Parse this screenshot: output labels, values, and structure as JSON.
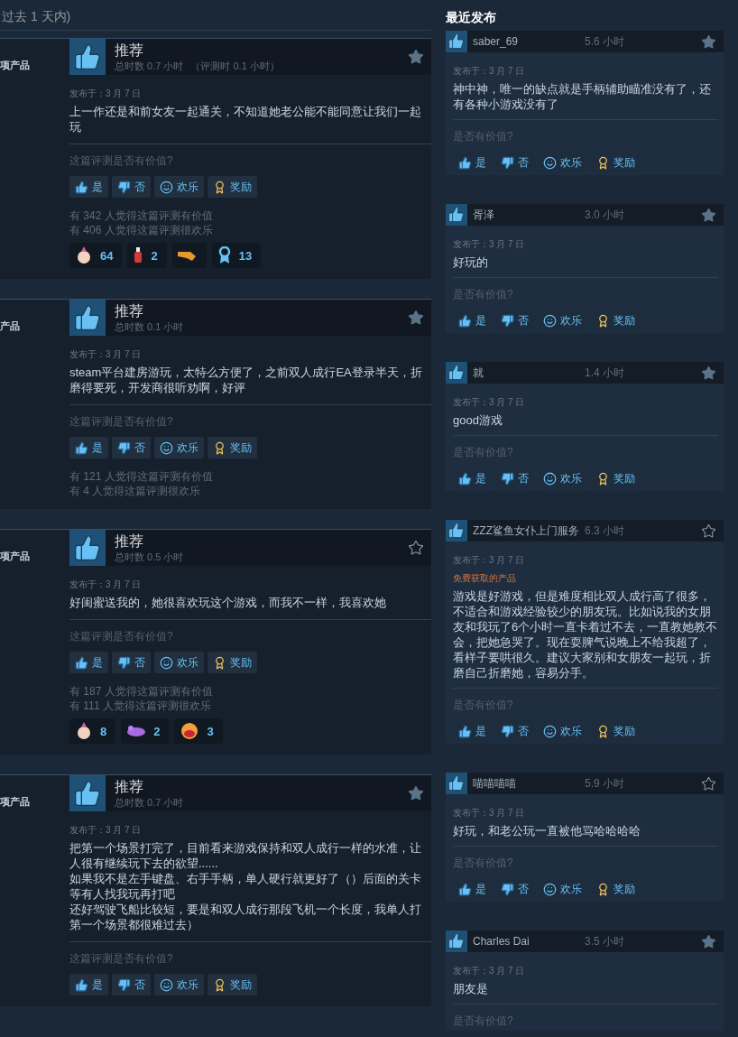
{
  "filter_note": "过去 1 天内)",
  "reviews": [
    {
      "author_fragment": "项产品",
      "verdict": "推荐",
      "playtime": "总时数 0.7 小时",
      "review_time": "（评测时 0.1 小时）",
      "starred": true,
      "posted": "发布于：3 月 7 日",
      "body": "上一作还是和前女友一起通关，不知道她老公能不能同意让我们一起玩",
      "question": "这篇评测是否有价值?",
      "vote_buttons": [
        {
          "kind": "yes",
          "label": "是"
        },
        {
          "kind": "no",
          "label": "否"
        },
        {
          "kind": "funny",
          "label": "欢乐"
        },
        {
          "kind": "award",
          "label": "奖励"
        }
      ],
      "stats": [
        "有 342 人觉得这篇评测有价值",
        "有 406 人觉得这篇评测很欢乐"
      ],
      "reactions": [
        {
          "kind": "clown",
          "count": "64"
        },
        {
          "kind": "potion",
          "count": "2"
        },
        {
          "kind": "hand"
        },
        {
          "kind": "medal",
          "count": "13"
        }
      ]
    },
    {
      "author_fragment": "产品",
      "verdict": "推荐",
      "playtime": "总时数 0.1 小时",
      "starred": true,
      "posted": "发布于：3 月 7 日",
      "body": "steam平台建房游玩，太特么方便了，之前双人成行EA登录半天，折磨得要死，开发商很听劝啊，好评",
      "question": "这篇评测是否有价值?",
      "vote_buttons": [
        {
          "kind": "yes",
          "label": "是"
        },
        {
          "kind": "no",
          "label": "否"
        },
        {
          "kind": "funny",
          "label": "欢乐"
        },
        {
          "kind": "award",
          "label": "奖励"
        }
      ],
      "stats": [
        "有 121 人觉得这篇评测有价值",
        "有 4 人觉得这篇评测很欢乐"
      ]
    },
    {
      "author_fragment": "项产品",
      "verdict": "推荐",
      "playtime": "总时数 0.5 小时",
      "starred": false,
      "posted": "发布于：3 月 7 日",
      "body": "好闺蜜送我的，她很喜欢玩这个游戏，而我不一样，我喜欢她",
      "question": "这篇评测是否有价值?",
      "vote_buttons": [
        {
          "kind": "yes",
          "label": "是"
        },
        {
          "kind": "no",
          "label": "否"
        },
        {
          "kind": "funny",
          "label": "欢乐"
        },
        {
          "kind": "award",
          "label": "奖励"
        }
      ],
      "stats": [
        "有 187 人觉得这篇评测有价值",
        "有 111 人觉得这篇评测很欢乐"
      ],
      "reactions": [
        {
          "kind": "clown",
          "count": "8"
        },
        {
          "kind": "blob",
          "count": "2"
        },
        {
          "kind": "laugh",
          "count": "3"
        }
      ]
    },
    {
      "author_fragment": "项产品",
      "verdict": "推荐",
      "playtime": "总时数 0.7 小时",
      "starred": true,
      "posted": "发布于：3 月 7 日",
      "body": [
        "把第一个场景打完了，目前看来游戏保持和双人成行一样的水准，让人很有继续玩下去的欲望......",
        "如果我不是左手键盘、右手手柄，单人硬行就更好了（）后面的关卡等有人找我玩再打吧",
        "还好驾驶飞船比较短，要是和双人成行那段飞机一个长度，我单人打第一个场景都很难过去）"
      ],
      "question": "这篇评测是否有价值?",
      "vote_buttons": [
        {
          "kind": "yes",
          "label": "是"
        },
        {
          "kind": "no",
          "label": "否"
        },
        {
          "kind": "funny",
          "label": "欢乐"
        },
        {
          "kind": "award",
          "label": "奖励"
        }
      ]
    }
  ],
  "recent": {
    "title": "最近发布",
    "reviews": [
      {
        "author": "saber_69",
        "hours": "5.6 小时",
        "starred": true,
        "posted": "发布于：3 月 7 日",
        "body": "神中神，唯一的缺点就是手柄辅助瞄准没有了，还有各种小游戏没有了",
        "question": "是否有价值?",
        "vote_buttons": [
          {
            "kind": "yes",
            "label": "是"
          },
          {
            "kind": "no",
            "label": "否"
          },
          {
            "kind": "funny",
            "label": "欢乐"
          },
          {
            "kind": "award",
            "label": "奖励"
          }
        ]
      },
      {
        "author": "胥泽",
        "hours": "3.0 小时",
        "starred": true,
        "posted": "发布于：3 月 7 日",
        "body": "好玩的",
        "question": "是否有价值?",
        "vote_buttons": [
          {
            "kind": "yes",
            "label": "是"
          },
          {
            "kind": "no",
            "label": "否"
          },
          {
            "kind": "funny",
            "label": "欢乐"
          },
          {
            "kind": "award",
            "label": "奖励"
          }
        ]
      },
      {
        "author": "就",
        "hours": "1.4 小时",
        "starred": true,
        "posted": "发布于：3 月 7 日",
        "body": "good游戏",
        "question": "是否有价值?",
        "vote_buttons": [
          {
            "kind": "yes",
            "label": "是"
          },
          {
            "kind": "no",
            "label": "否"
          },
          {
            "kind": "funny",
            "label": "欢乐"
          },
          {
            "kind": "award",
            "label": "奖励"
          }
        ]
      },
      {
        "author": "ZZZ鲨鱼女仆上门服务",
        "hours": "6.3 小时",
        "starred": false,
        "posted": "发布于：3 月 7 日",
        "free_label": "免费获取的产品",
        "body": "游戏是好游戏，但是难度相比双人成行高了很多，不适合和游戏经验较少的朋友玩。比如说我的女朋友和我玩了6个小时一直卡着过不去，一直教她教不会，把她急哭了。现在耍脾气说晚上不给我超了，看样子要哄很久。建议大家别和女朋友一起玩，折磨自己折磨她，容易分手。",
        "question": "是否有价值?",
        "vote_buttons": [
          {
            "kind": "yes",
            "label": "是"
          },
          {
            "kind": "no",
            "label": "否"
          },
          {
            "kind": "funny",
            "label": "欢乐"
          },
          {
            "kind": "award",
            "label": "奖励"
          }
        ]
      },
      {
        "author": "喵喵喵喵",
        "hours": "5.9 小时",
        "starred": false,
        "posted": "发布于：3 月 7 日",
        "body": "好玩，和老公玩一直被他骂哈哈哈哈",
        "question": "是否有价值?",
        "vote_buttons": [
          {
            "kind": "yes",
            "label": "是"
          },
          {
            "kind": "no",
            "label": "否"
          },
          {
            "kind": "funny",
            "label": "欢乐"
          },
          {
            "kind": "award",
            "label": "奖励"
          }
        ]
      },
      {
        "author": "Charles Dai",
        "hours": "3.5 小时",
        "starred": true,
        "posted": "发布于：3 月 7 日",
        "body": "朋友是",
        "question": "是否有价值?"
      }
    ]
  }
}
